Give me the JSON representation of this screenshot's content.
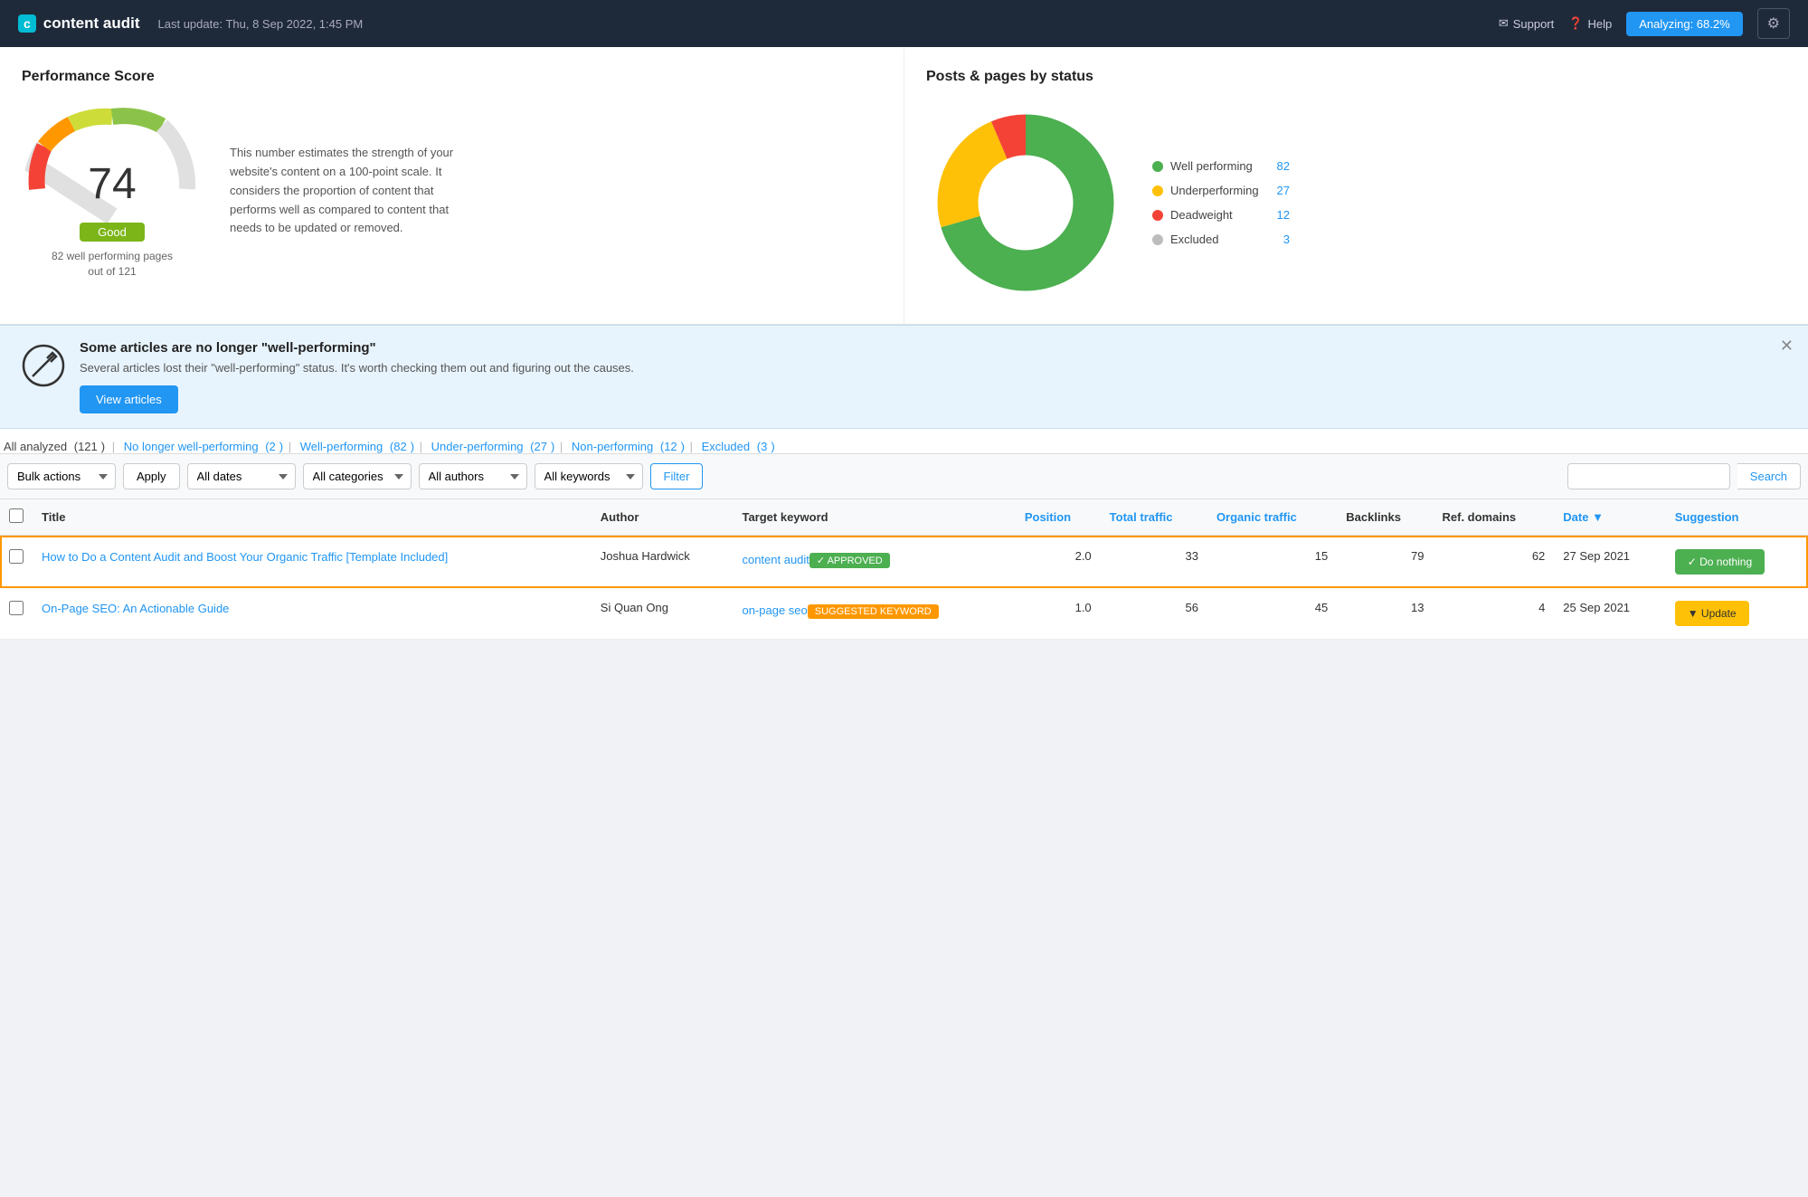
{
  "header": {
    "logo_icon": "c",
    "logo_text": "content audit",
    "last_update": "Last update: Thu, 8 Sep 2022, 1:45 PM",
    "support_label": "Support",
    "help_label": "Help",
    "analyzing_label": "Analyzing: 68.2%",
    "gear_label": "⚙"
  },
  "performance": {
    "title": "Performance Score",
    "score": "74",
    "grade": "Good",
    "subtitle": "82 well performing pages\nout of 121",
    "description": "This number estimates the strength of your website's content on a 100-point scale. It considers the proportion of content that performs well as compared to content that needs to be updated or removed."
  },
  "posts_by_status": {
    "title": "Posts & pages by status",
    "legend": [
      {
        "label": "Well performing",
        "count": "82",
        "color": "#4CAF50"
      },
      {
        "label": "Underperforming",
        "count": "27",
        "color": "#FFC107"
      },
      {
        "label": "Deadweight",
        "count": "12",
        "color": "#F44336"
      },
      {
        "label": "Excluded",
        "count": "3",
        "color": "#BDBDBD"
      }
    ]
  },
  "alert": {
    "title": "Some articles are no longer \"well-performing\"",
    "description": "Several articles lost their \"well-performing\" status. It's worth checking them out and figuring out the causes.",
    "button_label": "View articles"
  },
  "filter_tabs": {
    "all_analyzed_label": "All analyzed",
    "all_analyzed_count": "121",
    "no_longer_label": "No longer well-performing",
    "no_longer_count": "2",
    "well_performing_label": "Well-performing",
    "well_performing_count": "82",
    "under_performing_label": "Under-performing",
    "under_performing_count": "27",
    "non_performing_label": "Non-performing",
    "non_performing_count": "12",
    "excluded_label": "Excluded",
    "excluded_count": "3"
  },
  "toolbar": {
    "bulk_actions_label": "Bulk actions",
    "apply_label": "Apply",
    "all_dates_label": "All dates",
    "all_categories_label": "All categories",
    "all_authors_label": "All authors",
    "all_keywords_label": "All keywords",
    "filter_label": "Filter",
    "search_label": "Search",
    "search_placeholder": ""
  },
  "table": {
    "columns": [
      "Title",
      "Author",
      "Target keyword",
      "Position",
      "Total traffic",
      "Organic traffic",
      "Backlinks",
      "Ref. domains",
      "Date",
      "Suggestion"
    ],
    "rows": [
      {
        "title": "How to Do a Content Audit and Boost Your Organic Traffic [Template Included]",
        "author": "Joshua Hardwick",
        "keyword": "content audit",
        "keyword_badge": "APPROVED",
        "keyword_badge_type": "approved",
        "position": "2.0",
        "total_traffic": "33",
        "organic_traffic": "15",
        "backlinks": "79",
        "ref_domains": "62",
        "date": "27 Sep 2021",
        "suggestion": "Do nothing",
        "suggestion_type": "do_nothing",
        "highlighted": true
      },
      {
        "title": "On-Page SEO: An Actionable Guide",
        "author": "Si Quan Ong",
        "keyword": "on-page seo",
        "keyword_badge": "SUGGESTED KEYWORD",
        "keyword_badge_type": "suggested",
        "position": "1.0",
        "total_traffic": "56",
        "organic_traffic": "45",
        "backlinks": "13",
        "ref_domains": "4",
        "date": "25 Sep 2021",
        "suggestion": "Update",
        "suggestion_type": "update",
        "highlighted": false
      }
    ]
  }
}
